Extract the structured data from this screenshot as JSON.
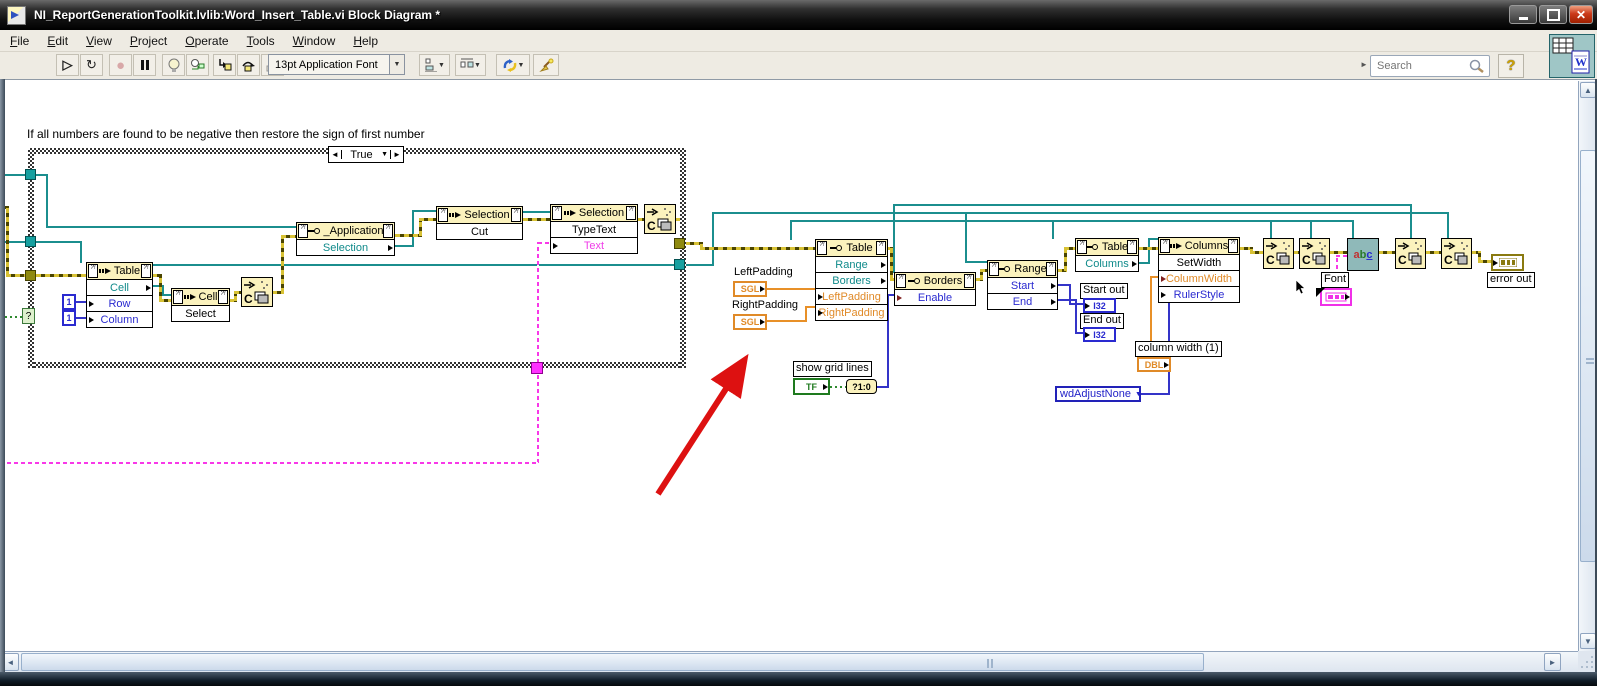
{
  "window": {
    "title": "NI_ReportGenerationToolkit.lvlib:Word_Insert_Table.vi Block Diagram *"
  },
  "menu": {
    "items": [
      "File",
      "Edit",
      "View",
      "Project",
      "Operate",
      "Tools",
      "Window",
      "Help"
    ]
  },
  "toolbar": {
    "font_selector": "13pt Application Font",
    "search_placeholder": "Search",
    "help_label": "?"
  },
  "icons": {
    "dropdown": "▼",
    "case_prev": "◄",
    "case_next": "►",
    "run": "▷",
    "run_continuous": "↻",
    "abort": "●",
    "scroll_up": "▲",
    "scroll_down": "▼",
    "scroll_left": "◄",
    "scroll_right": "►"
  },
  "diagram": {
    "comment": "If all numbers are found to be negative then restore the sign of first number",
    "case_selector": "True",
    "nodes": {
      "table_cell": {
        "title": "Table",
        "rows": [
          "Cell",
          "Row",
          "Column"
        ]
      },
      "cell": {
        "title": "Cell",
        "rows": [
          "Select"
        ]
      },
      "application": {
        "title": "_Application",
        "rows": [
          "Selection"
        ]
      },
      "selection_cut": {
        "title": "Selection",
        "rows": [
          "Cut"
        ]
      },
      "selection_type": {
        "title": "Selection",
        "rows": [
          "TypeText",
          "Text"
        ]
      },
      "table_format": {
        "title": "Table",
        "rows": [
          "Range",
          "Borders",
          "LeftPadding",
          "RightPadding"
        ]
      },
      "borders": {
        "title": "Borders",
        "rows": [
          "Enable"
        ]
      },
      "range": {
        "title": "Range",
        "rows": [
          "Start",
          "End"
        ]
      },
      "table_columns": {
        "title": "Table",
        "rows": [
          "Columns"
        ]
      },
      "columns": {
        "title": "Columns",
        "rows": [
          "SetWidth",
          "ColumnWidth",
          "RulerStyle"
        ]
      }
    },
    "terminals": {
      "const_row": "1",
      "const_col": "1",
      "sgl_label": "SGL",
      "tf_label": "TF",
      "bool_to_num": "?1:0",
      "i32_label": "I32",
      "dbl_label": "DBL",
      "enum_value": "wdAdjustNone",
      "error_out_label": "error out",
      "abc_a": "a",
      "abc_b": "b",
      "abc_c": "c",
      "font_label": "Font"
    },
    "labels": {
      "left_padding": "LeftPadding",
      "right_padding": "RightPadding",
      "show_grid_lines": "show grid lines",
      "start_out": "Start out",
      "end_out": "End out",
      "column_width": "column width (1)"
    },
    "colors": {
      "refnum_teal": "#1b8e8e",
      "numeric_blue": "#3434c8",
      "float_orange": "#e89028",
      "string_pink": "#f838e8",
      "error_olive": "#8a7a10",
      "boolean_green": "#2e8a2e",
      "node_header_yellow": "#fbf2bd",
      "annotation_red": "#dd1111"
    }
  }
}
